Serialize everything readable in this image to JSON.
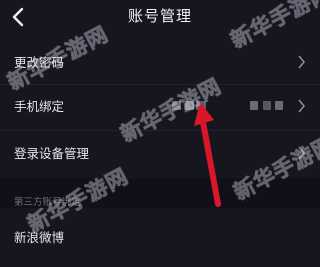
{
  "header": {
    "title": "账号管理",
    "back_icon": "chevron-left-icon"
  },
  "rows": [
    {
      "label": "更改密码",
      "chevron": true
    },
    {
      "label": "手机绑定",
      "value": "[masked]",
      "chevron": true
    },
    {
      "label": "登录设备管理",
      "chevron": true
    }
  ],
  "section": {
    "title": "第三方账号绑定"
  },
  "third_party": [
    {
      "label": "新浪微博"
    }
  ],
  "watermark": {
    "text": "新华手游网"
  },
  "colors": {
    "background": "#16161f",
    "annotation_arrow": "#d8182a"
  }
}
